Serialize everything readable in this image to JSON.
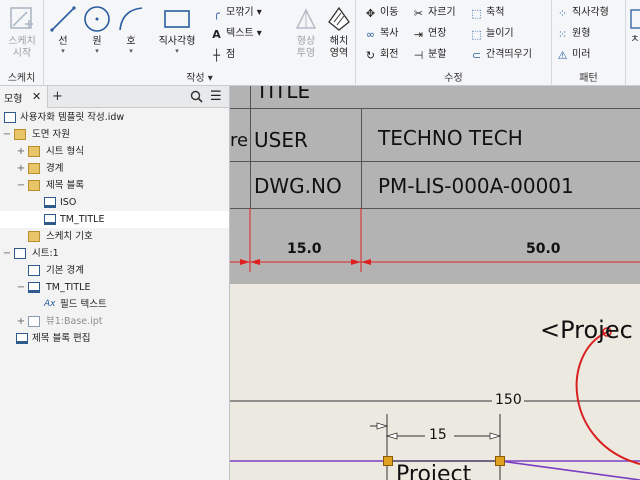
{
  "ribbon": {
    "sketch_group": {
      "label": "스케치",
      "start_label_1": "스케치",
      "start_label_2": "시작"
    },
    "create_group": {
      "label": "작성 ▾",
      "line": "선",
      "circle": "원",
      "arc": "호",
      "rectangle": "직사각형",
      "fillet": "모깎기 ▾",
      "text": "텍스트 ▾",
      "point": "점",
      "format_1": "형상",
      "format_2": "투영",
      "hatch_1": "해치",
      "hatch_2": "영역"
    },
    "modify_group": {
      "label": "수정",
      "move": "이동",
      "trim": "자르기",
      "scale": "축척",
      "copy": "복사",
      "extend": "연장",
      "stretch": "늘이기",
      "rotate": "회전",
      "split": "분할",
      "offset": "간격띄우기"
    },
    "pattern_group": {
      "label": "패턴",
      "rect_pattern": "직사각형",
      "circ_pattern": "원형",
      "mirror": "미러"
    },
    "extra_label": "ㅊ"
  },
  "browser": {
    "tab_label": "모형",
    "close_glyph": "✕",
    "add_glyph": "+",
    "menu_glyph": "☰",
    "tree": [
      {
        "label": "사용자화 템플릿 작성.idw"
      },
      {
        "label": "도면 자원"
      },
      {
        "label": "시트 형식"
      },
      {
        "label": "경계"
      },
      {
        "label": "제목 블록"
      },
      {
        "label": "ISO"
      },
      {
        "label": "TM_TITLE"
      },
      {
        "label": "스케치 기호"
      },
      {
        "label": "시트:1"
      },
      {
        "label": "기본 경계"
      },
      {
        "label": "TM_TITLE"
      },
      {
        "label": "필드 텍스트"
      },
      {
        "label": "뷰1:Base.ipt"
      },
      {
        "label": "제목 블록 편집"
      }
    ]
  },
  "canvas": {
    "title_block": {
      "title_cell": "TITLE",
      "label_user_prefix": "re",
      "user_label": "USER",
      "user_value": "TECHNO TECH",
      "dwg_label": "DWG.NO",
      "dwg_value": "PM-LIS-000A-00001",
      "dim_1": "15.0",
      "dim_2": "50.0"
    },
    "sheet": {
      "project_text": "<Projec",
      "dim_150": "150",
      "dim_15": "15",
      "project_box_text": "Project"
    }
  },
  "colors": {
    "ribbon_bg": "#f5f6f8",
    "accent_blue": "#2a5d9f",
    "dimension_red": "#e02020",
    "sketch_purple": "#7a3fc2",
    "handle_orange": "#e0a020"
  }
}
